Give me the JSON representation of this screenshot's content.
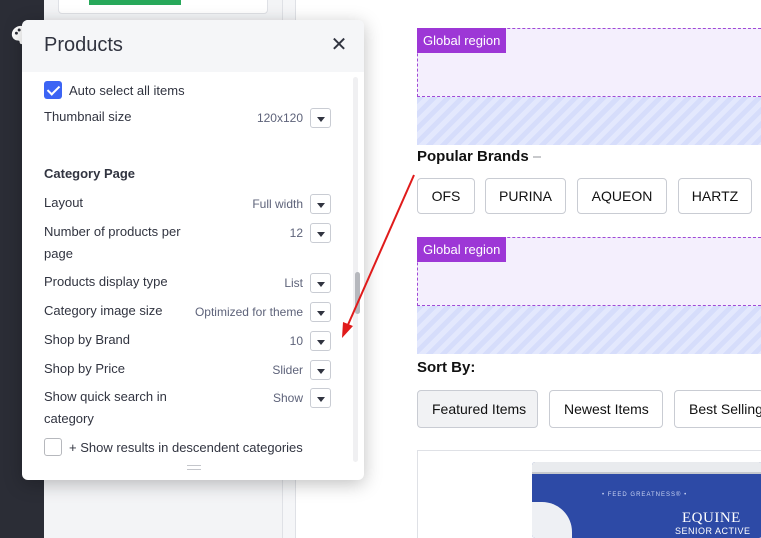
{
  "panel": {
    "title": "Products",
    "close_label": "✕",
    "auto_select_label": "Auto select all items",
    "thumbnail_label": "Thumbnail size",
    "thumbnail_value": "120x120",
    "category_heading": "Category Page",
    "rows": [
      {
        "label": "Layout",
        "value": "Full width"
      },
      {
        "label": "Number of products per page",
        "value": "12"
      },
      {
        "label": "Products display type",
        "value": "List"
      },
      {
        "label": "Category image size",
        "value": "Optimized for theme"
      },
      {
        "label": "Shop by Brand",
        "value": "10"
      },
      {
        "label": "Shop by Price",
        "value": "Slider"
      },
      {
        "label": "Show quick search in category",
        "value": "Show"
      }
    ],
    "descendent_label": "+ Show results in descendent categories"
  },
  "preview": {
    "global_region_label": "Global region",
    "popular_brands_title": "Popular Brands",
    "brands": [
      "OFS",
      "PURINA",
      "AQUEON",
      "HARTZ"
    ],
    "sort_by_title": "Sort By:",
    "sort_options": [
      "Featured Items",
      "Newest Items",
      "Best Selling"
    ],
    "product_bag": {
      "tagline": "• FEED GREATNESS® •",
      "brand": "EQUINE",
      "subtitle": "SENIOR ACTIVE"
    }
  },
  "colors": {
    "accent": "#3c64f4",
    "region_badge": "#9d37d6",
    "arrow": "#e01b1b"
  },
  "icons": {
    "app_strip": "palette-icon",
    "close": "close-icon",
    "dropdown": "chevron-down-icon"
  }
}
